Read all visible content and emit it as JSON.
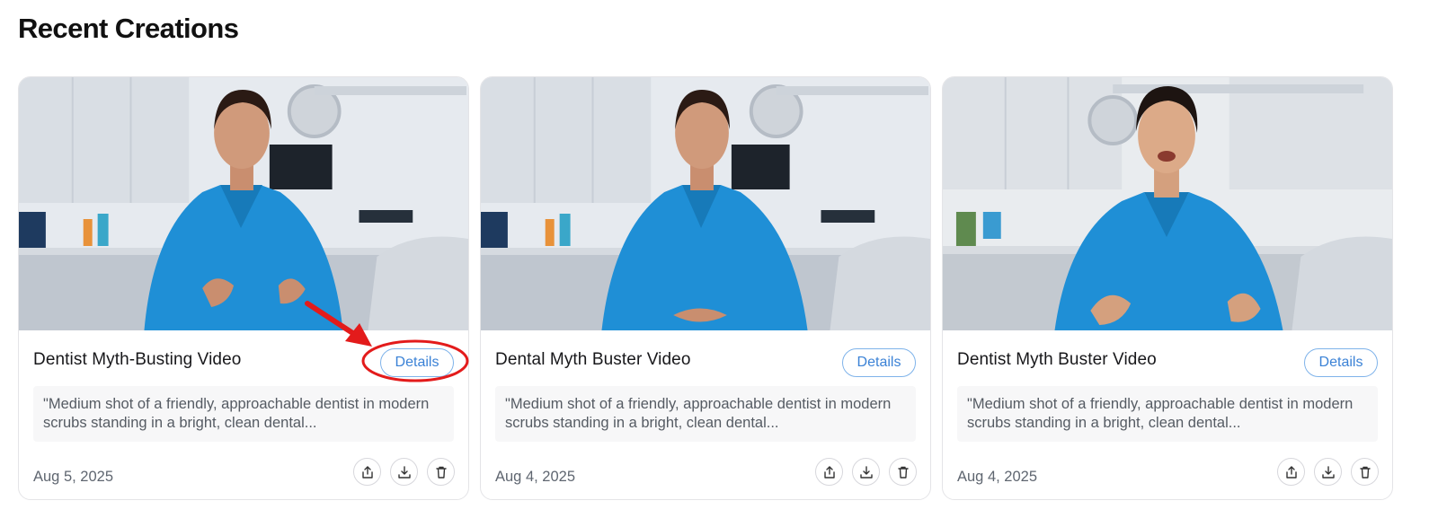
{
  "section": {
    "title": "Recent Creations"
  },
  "colors": {
    "accent": "#3b82d6",
    "annotation": "#e31b1b",
    "scrubs": "#1f8fd6"
  },
  "icons": {
    "share": "share-icon",
    "download": "download-icon",
    "delete": "trash-icon"
  },
  "cards": [
    {
      "title": "Dentist Myth-Busting Video",
      "details_label": "Details",
      "prompt": "\"Medium shot of a friendly, approachable dentist in modern scrubs standing in a bright, clean dental...",
      "date": "Aug 5, 2025"
    },
    {
      "title": "Dental Myth Buster Video",
      "details_label": "Details",
      "prompt": "\"Medium shot of a friendly, approachable dentist in modern scrubs standing in a bright, clean dental...",
      "date": "Aug 4, 2025"
    },
    {
      "title": "Dentist Myth Buster Video",
      "details_label": "Details",
      "prompt": "\"Medium shot of a friendly, approachable dentist in modern scrubs standing in a bright, clean dental...",
      "date": "Aug 4, 2025"
    }
  ]
}
